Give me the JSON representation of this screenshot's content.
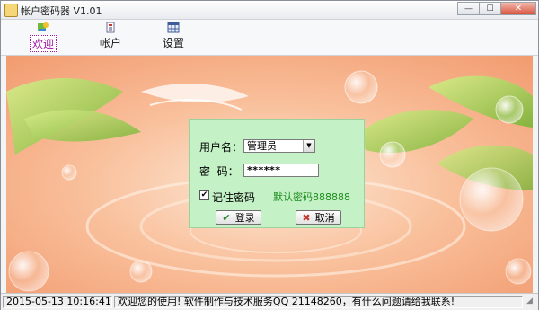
{
  "window": {
    "title": "帐户密码器 V1.01",
    "minimize_glyph": "0",
    "maximize_glyph": "1",
    "close_glyph": "r"
  },
  "toolbar": {
    "items": [
      {
        "label": "欢迎",
        "icon": "welcome-icon",
        "active": true
      },
      {
        "label": "帐户",
        "icon": "account-icon",
        "active": false
      },
      {
        "label": "设置",
        "icon": "settings-icon",
        "active": false
      }
    ]
  },
  "login": {
    "username_label": "用户名：",
    "username_value": "管理员",
    "password_label": "密  码：",
    "password_value": "******",
    "remember_label": "记住密码",
    "remember_checked": true,
    "default_hint": "默认密码888888",
    "login_button": "登录",
    "cancel_button": "取消"
  },
  "status": {
    "datetime": "2015-05-13 10:16:41",
    "message": "欢迎您的使用! 软件制作与技术服务QQ 21148260，有什么问题请给我联系!"
  },
  "colors": {
    "panel": "#c4f1c6",
    "hint": "#1f8d1f",
    "active_tab": "#a015a3",
    "background": "#f6b18b"
  }
}
